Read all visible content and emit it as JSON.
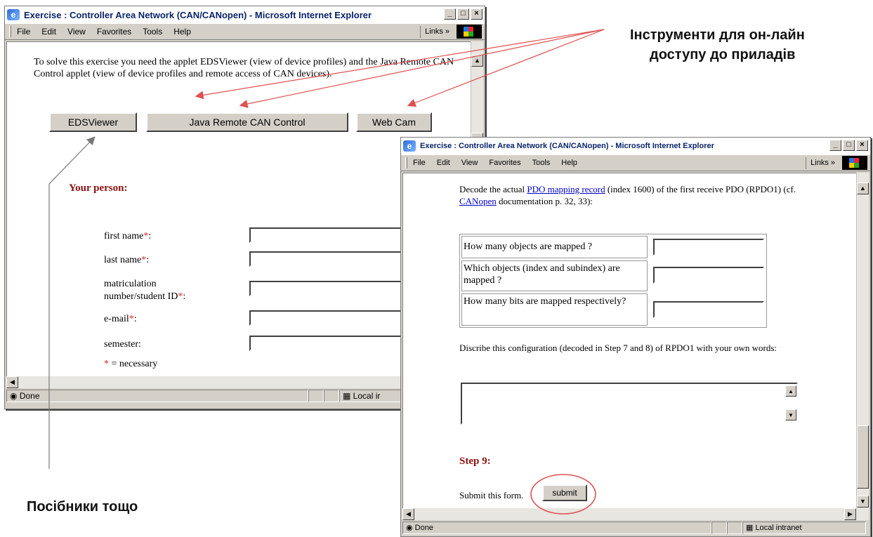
{
  "window1": {
    "title": "Exercise : Controller Area Network (CAN/CANopen) - Microsoft Internet Explorer",
    "menu": [
      "File",
      "Edit",
      "View",
      "Favorites",
      "Tools",
      "Help"
    ],
    "links": "Links »",
    "intro": "To solve this exercise you need the applet EDSViewer (view of device profiles) and the Java Remote CAN Control applet (view of device profiles and remote access of CAN devices).",
    "buttons": {
      "eds": "EDSViewer",
      "java": "Java Remote CAN Control",
      "webcam": "Web Cam"
    },
    "section_title": "Your person:",
    "form": {
      "first_name": "first name",
      "last_name": "last name",
      "matric_line1": "matriculation",
      "matric_line2": "number/student ID",
      "email": "e-mail",
      "semester": "semester:",
      "star": "*",
      "colon": ":",
      "necessary": "= necessary"
    },
    "status": {
      "done": "Done",
      "zone": "Local ir"
    }
  },
  "window2": {
    "title": "Exercise : Controller Area Network (CAN/CANopen) - Microsoft Internet Explorer",
    "menu": [
      "File",
      "Edit",
      "View",
      "Favorites",
      "Tools",
      "Help"
    ],
    "links": "Links »",
    "decode": {
      "pre": "Decode the actual ",
      "link1": "PDO mapping record",
      "mid": " (index 1600) of the first receive PDO (RPDO1) (cf. ",
      "link2": "CANopen",
      "post": " documentation p. 32, 33):"
    },
    "table": [
      "How many objects are mapped ?",
      "Which objects (index and subindex) are mapped ?",
      "How many bits are mapped respectively?"
    ],
    "describe": "Discribe this configuration (decoded in Step 7 and 8) of RPDO1 with your own words:",
    "step_title": "Step 9:",
    "submit_text": "Submit this form.",
    "submit_label": "submit",
    "status": {
      "done": "Done",
      "zone": "Local intranet"
    }
  },
  "annotations": {
    "tools_line1": "Інструменти для он-лайн",
    "tools_line2": "доступу до приладів",
    "guides": "Посібники тощо"
  },
  "colors": {
    "arrow": "#e05050",
    "heading": "#8b1010",
    "required_star": "#d22222"
  }
}
